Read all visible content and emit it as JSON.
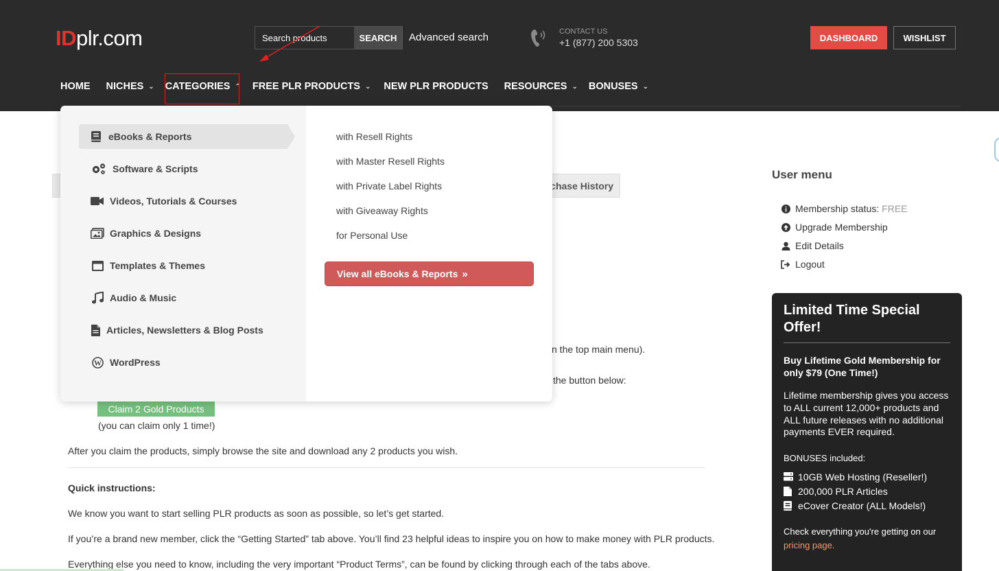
{
  "header": {
    "logo_id": "ID",
    "logo_rest": "plr.com",
    "search_placeholder": "Search products",
    "search_button": "SEARCH",
    "advanced_search": "Advanced search",
    "contact_label": "CONTACT US",
    "contact_phone": "+1 (877) 200 5303",
    "dashboard_button": "DASHBOARD",
    "wishlist_button": "WISHLIST"
  },
  "nav": {
    "items": [
      {
        "label": "HOME",
        "has_dropdown": false
      },
      {
        "label": "NICHES",
        "has_dropdown": true
      },
      {
        "label": "CATEGORIES",
        "has_dropdown": true,
        "open": true
      },
      {
        "label": "FREE PLR PRODUCTS",
        "has_dropdown": true
      },
      {
        "label": "NEW PLR PRODUCTS",
        "has_dropdown": false
      },
      {
        "label": "RESOURCES",
        "has_dropdown": true
      },
      {
        "label": "BONUSES",
        "has_dropdown": true
      }
    ]
  },
  "dropdown": {
    "categories": [
      {
        "label": "eBooks & Reports",
        "icon": "book-icon",
        "active": true
      },
      {
        "label": "Software & Scripts",
        "icon": "gears-icon"
      },
      {
        "label": "Videos, Tutorials & Courses",
        "icon": "video-camera-icon"
      },
      {
        "label": "Graphics & Designs",
        "icon": "images-icon"
      },
      {
        "label": "Templates & Themes",
        "icon": "window-icon"
      },
      {
        "label": "Audio & Music",
        "icon": "music-note-icon"
      },
      {
        "label": "Articles, Newsletters & Blog Posts",
        "icon": "document-icon"
      },
      {
        "label": "WordPress",
        "icon": "wordpress-icon"
      }
    ],
    "subitems": [
      "with Resell Rights",
      "with Master Resell Rights",
      "with Private Label Rights",
      "with Giveaway Rights",
      "for Personal Use"
    ],
    "view_all": "View all eBooks & Reports"
  },
  "main": {
    "tab_purchase_history": "chase History",
    "partial_line_1": "n the top main menu).",
    "partial_line_2": "the button below:",
    "claim_button": "Claim 2 Gold Products",
    "claim_note": "(you can claim only 1 time!)",
    "after_claim": "After you claim the products, simply browse the site and download any 2 products you wish.",
    "quick_heading": "Quick instructions:",
    "para1": "We know you want to start selling PLR products as soon as possible, so let’s get started.",
    "para2": "If you’re a brand new member, click the “Getting Started” tab above. You’ll find 23 helpful ideas to inspire you on how to make money with PLR products.",
    "para3": "Everything else you need to know, including the very important “Product Terms”, can be found by clicking through each of the tabs above."
  },
  "sidebar": {
    "user_menu_title": "User menu",
    "membership_label": "Membership status:",
    "membership_value": "FREE",
    "upgrade": "Upgrade Membership",
    "edit": "Edit Details",
    "logout": "Logout",
    "offer": {
      "title": "Limited Time Special Offer!",
      "subtitle": "Buy Lifetime Gold Membership for only $79 (One Time!)",
      "description": "Lifetime membership gives you access to ALL current 12,000+ products and ALL future releases with no additional payments EVER required.",
      "bonuses_label": "BONUSES included:",
      "bonuses": [
        {
          "label": "10GB Web Hosting (Reseller!)",
          "icon": "server-icon"
        },
        {
          "label": "200,000 PLR Articles",
          "icon": "file-icon"
        },
        {
          "label": "eCover Creator (ALL Models!)",
          "icon": "book-icon"
        }
      ],
      "check_text": "Check everything you're getting on our",
      "pricing_link": "pricing page."
    }
  },
  "colors": {
    "header_bg": "#2b2b2b",
    "accent_red": "#e54b45",
    "view_all_bg": "#d05a5a",
    "claim_green": "#76c07f",
    "offer_bg": "#232323"
  }
}
